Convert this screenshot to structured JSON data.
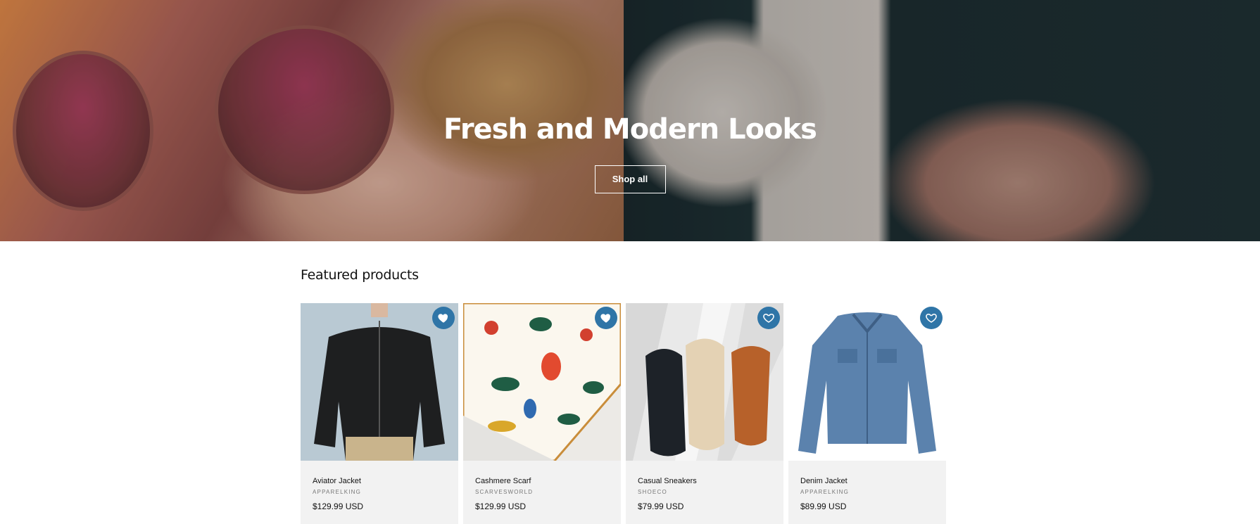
{
  "hero": {
    "title": "Fresh and Modern Looks",
    "button_label": "Shop all"
  },
  "featured": {
    "heading": "Featured products",
    "products": [
      {
        "name": "Aviator Jacket",
        "vendor": "APPARELKING",
        "price": "$129.99 USD",
        "favorited": true
      },
      {
        "name": "Cashmere Scarf",
        "vendor": "SCARVESWORLD",
        "price": "$129.99 USD",
        "favorited": true
      },
      {
        "name": "Casual Sneakers",
        "vendor": "SHOECO",
        "price": "$79.99 USD",
        "favorited": false
      },
      {
        "name": "Denim Jacket",
        "vendor": "APPARELKING",
        "price": "$89.99 USD",
        "favorited": false
      }
    ]
  },
  "colors": {
    "favorite_button": "#2f75a7",
    "card_info_bg": "#f2f2f2"
  },
  "icons": {
    "favorite": "heart-icon"
  }
}
